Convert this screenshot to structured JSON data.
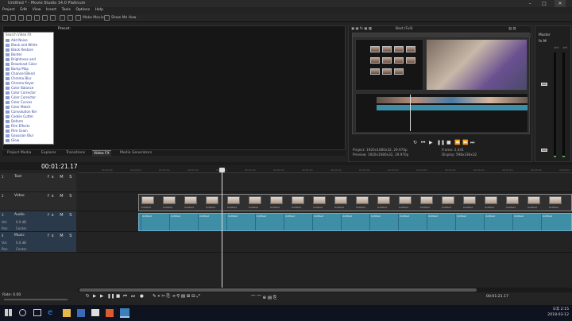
{
  "window": {
    "title": "Untitled * - Movie Studio 14.0 Platinum"
  },
  "menu": [
    "Project",
    "Edit",
    "View",
    "Insert",
    "Tools",
    "Options",
    "Help"
  ],
  "toolbar": {
    "make_movie": "Make Movie",
    "show_me_how": "Show Me How"
  },
  "explorer": {
    "search_placeholder": "Search Video FX",
    "preset_label": "Preset:",
    "fx_items": [
      "Add Noise",
      "Black and White",
      "Black Restore",
      "Border",
      "Brightness and",
      "Broadcast Color",
      "Bump Map",
      "Channel Blend",
      "Chroma Blur",
      "Chroma Keyer",
      "Color Balance",
      "Color Corrector",
      "Color Corrector",
      "Color Curves",
      "Color Match",
      "Convolution Ker",
      "Cookie Cutter",
      "Deform",
      "Film Effects",
      "Film Grain",
      "Gaussian Blur",
      "Glow"
    ],
    "tabs": [
      "Project Media",
      "Explorer",
      "Transitions",
      "Video FX",
      "Media Generators"
    ],
    "active_tab": "Video FX"
  },
  "preview": {
    "quality": "Best (Full)",
    "project": "Project:  1920x1080x32, 29.970p",
    "preview_res": "Preview: 1920x1080x32, 29.970p",
    "frame": "Frame:    2,441",
    "display": "Display:  598x336x32"
  },
  "master": {
    "title": "Master",
    "fx": "fx  M",
    "labels": [
      "-Inf.",
      "-Inf."
    ]
  },
  "timeline": {
    "timecode": "00:01:21.17",
    "ruler": [
      "00:00:00",
      "00:00:20",
      "00:00:40",
      "00:01:00",
      "00:01:20",
      "00:01:40",
      "00:02:00",
      "00:02:20",
      "00:02:40",
      "00:03:00",
      "00:03:20",
      "00:03:40",
      "00:04:00",
      "00:04:20",
      "00:04:40",
      "00:05:00",
      "00:05:20"
    ],
    "tracks": [
      {
        "num": "1",
        "name": "Text",
        "ctrls": "fx M S"
      },
      {
        "num": "2",
        "name": "Video",
        "ctrls": "fx M S"
      },
      {
        "num": "3",
        "name": "Audio",
        "ctrls": "fx M S",
        "vol": "Vol:",
        "vol_val": "0.0 dB",
        "pan": "Pan:",
        "pan_val": "Center"
      },
      {
        "num": "4",
        "name": "Music",
        "ctrls": "fx M S",
        "vol": "Vol:",
        "vol_val": "0.0 dB",
        "pan": "Pan:",
        "pan_val": "Center"
      }
    ],
    "clip_name": "Untitled"
  },
  "transport": {
    "rate": "Rate: 0.00",
    "timecode": "00:01:21.17"
  },
  "taskbar": {
    "time": "오후 2:15",
    "date": "2018-03-12"
  },
  "colors": {
    "audio_clip": "#3e8fa6",
    "fx_text": "#33469d"
  }
}
